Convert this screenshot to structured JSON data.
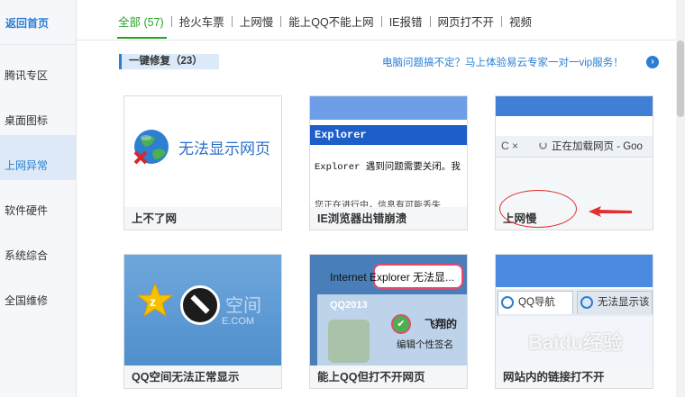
{
  "sidebar": {
    "home": "返回首页",
    "items": [
      {
        "label": "腾讯专区"
      },
      {
        "label": "桌面图标"
      },
      {
        "label": "上网异常"
      },
      {
        "label": "软件硬件"
      },
      {
        "label": "系统综合"
      },
      {
        "label": "全国维修"
      }
    ],
    "active_index": 2
  },
  "tabs": [
    {
      "label": "全部 (57)",
      "active": true
    },
    {
      "label": "抢火车票"
    },
    {
      "label": "上网慢"
    },
    {
      "label": "能上QQ不能上网"
    },
    {
      "label": "IE报错"
    },
    {
      "label": "网页打不开"
    },
    {
      "label": "视频"
    }
  ],
  "section": {
    "title": "一键修复（23）",
    "promo": "电脑问题搞不定？马上体验易云专家一对一vip服务！",
    "promo_arrow": "›"
  },
  "cards": [
    {
      "label": "上不了网",
      "img_text": "无法显示网页"
    },
    {
      "label": "IE浏览器出错崩溃",
      "img_title": "Explorer",
      "img_body": "Explorer 遇到问题需要关闭。我",
      "img_body2": "您正在进行中，信息有可能丢失"
    },
    {
      "label": "上网慢",
      "img_url": "正在加载网页 - Goo",
      "img_nav": "C ×"
    },
    {
      "label": "QQ空间无法正常显示",
      "img_text": "空间",
      "img_domain": "E.COM"
    },
    {
      "label": "能上QQ但打不开网页",
      "img_header": "Internet Explorer 无法显...",
      "img_qq": "QQ2013",
      "img_nick": "飞翔的",
      "img_sign": "编辑个性签名"
    },
    {
      "label": "网站内的链接打不开",
      "img_tab1": "QQ导航",
      "img_tab2": "无法显示该"
    }
  ],
  "watermark": "Baidu经验",
  "colors": {
    "accent_blue": "#2a7fd4",
    "tab_green": "#27a427",
    "annotation_red": "#e03030"
  }
}
